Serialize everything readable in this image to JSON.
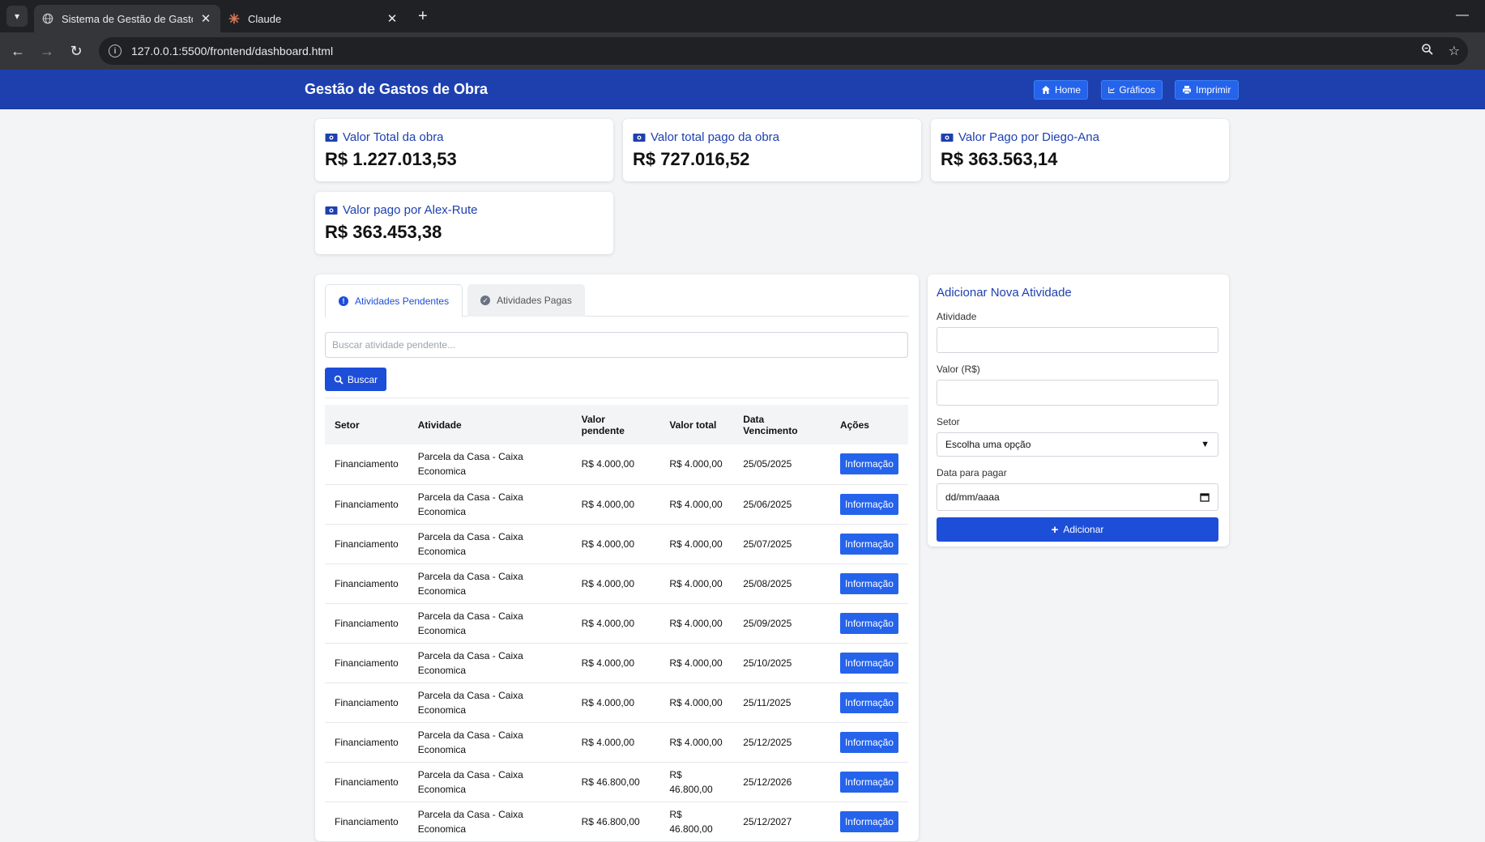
{
  "browser": {
    "tabs": [
      {
        "title": "Sistema de Gestão de Gastos de",
        "active": true
      },
      {
        "title": "Claude",
        "active": false
      }
    ],
    "url": "127.0.0.1:5500/frontend/dashboard.html"
  },
  "header": {
    "title": "Gestão de Gastos de Obra",
    "buttons": {
      "home": "Home",
      "graficos": "Gráficos",
      "imprimir": "Imprimir"
    }
  },
  "summary": [
    {
      "label": "Valor Total da obra",
      "value": "R$ 1.227.013,53"
    },
    {
      "label": "Valor total pago da obra",
      "value": "R$ 727.016,52"
    },
    {
      "label": "Valor Pago por Diego-Ana",
      "value": "R$ 363.563,14"
    },
    {
      "label": "Valor pago por Alex-Rute",
      "value": "R$ 363.453,38"
    }
  ],
  "activities": {
    "tabs": {
      "pending": "Atividades Pendentes",
      "paid": "Atividades Pagas"
    },
    "search_placeholder": "Buscar atividade pendente...",
    "search_button": "Buscar",
    "columns": {
      "setor": "Setor",
      "atividade": "Atividade",
      "valor_pendente_1": "Valor",
      "valor_pendente_2": "pendente",
      "valor_total": "Valor total",
      "data_1": "Data",
      "data_2": "Vencimento",
      "acoes": "Ações"
    },
    "rows": [
      {
        "setor": "Financiamento",
        "atividade_1": "Parcela da Casa - Caixa",
        "atividade_2": "Economica",
        "pendente": "R$ 4.000,00",
        "total_1": "R$ 4.000,00",
        "total_2": "",
        "data": "25/05/2025",
        "acao": "Informação"
      },
      {
        "setor": "Financiamento",
        "atividade_1": "Parcela da Casa - Caixa",
        "atividade_2": "Economica",
        "pendente": "R$ 4.000,00",
        "total_1": "R$ 4.000,00",
        "total_2": "",
        "data": "25/06/2025",
        "acao": "Informação"
      },
      {
        "setor": "Financiamento",
        "atividade_1": "Parcela da Casa - Caixa",
        "atividade_2": "Economica",
        "pendente": "R$ 4.000,00",
        "total_1": "R$ 4.000,00",
        "total_2": "",
        "data": "25/07/2025",
        "acao": "Informação"
      },
      {
        "setor": "Financiamento",
        "atividade_1": "Parcela da Casa - Caixa",
        "atividade_2": "Economica",
        "pendente": "R$ 4.000,00",
        "total_1": "R$ 4.000,00",
        "total_2": "",
        "data": "25/08/2025",
        "acao": "Informação"
      },
      {
        "setor": "Financiamento",
        "atividade_1": "Parcela da Casa - Caixa",
        "atividade_2": "Economica",
        "pendente": "R$ 4.000,00",
        "total_1": "R$ 4.000,00",
        "total_2": "",
        "data": "25/09/2025",
        "acao": "Informação"
      },
      {
        "setor": "Financiamento",
        "atividade_1": "Parcela da Casa - Caixa",
        "atividade_2": "Economica",
        "pendente": "R$ 4.000,00",
        "total_1": "R$ 4.000,00",
        "total_2": "",
        "data": "25/10/2025",
        "acao": "Informação"
      },
      {
        "setor": "Financiamento",
        "atividade_1": "Parcela da Casa - Caixa",
        "atividade_2": "Economica",
        "pendente": "R$ 4.000,00",
        "total_1": "R$ 4.000,00",
        "total_2": "",
        "data": "25/11/2025",
        "acao": "Informação"
      },
      {
        "setor": "Financiamento",
        "atividade_1": "Parcela da Casa - Caixa",
        "atividade_2": "Economica",
        "pendente": "R$ 4.000,00",
        "total_1": "R$ 4.000,00",
        "total_2": "",
        "data": "25/12/2025",
        "acao": "Informação"
      },
      {
        "setor": "Financiamento",
        "atividade_1": "Parcela da Casa - Caixa",
        "atividade_2": "Economica",
        "pendente": "R$ 46.800,00",
        "total_1": "R$",
        "total_2": "46.800,00",
        "data": "25/12/2026",
        "acao": "Informação"
      },
      {
        "setor": "Financiamento",
        "atividade_1": "Parcela da Casa - Caixa",
        "atividade_2": "Economica",
        "pendente": "R$ 46.800,00",
        "total_1": "R$",
        "total_2": "46.800,00",
        "data": "25/12/2027",
        "acao": "Informação"
      }
    ]
  },
  "form": {
    "title": "Adicionar Nova Atividade",
    "atividade_label": "Atividade",
    "valor_label": "Valor (R$)",
    "setor_label": "Setor",
    "setor_selected": "Escolha uma opção",
    "data_label": "Data para pagar",
    "data_value": "dd/mm/aaaa",
    "submit": "Adicionar"
  },
  "colors": {
    "primary": "#1e40af",
    "button": "#2563eb",
    "chrome": "#202124"
  }
}
